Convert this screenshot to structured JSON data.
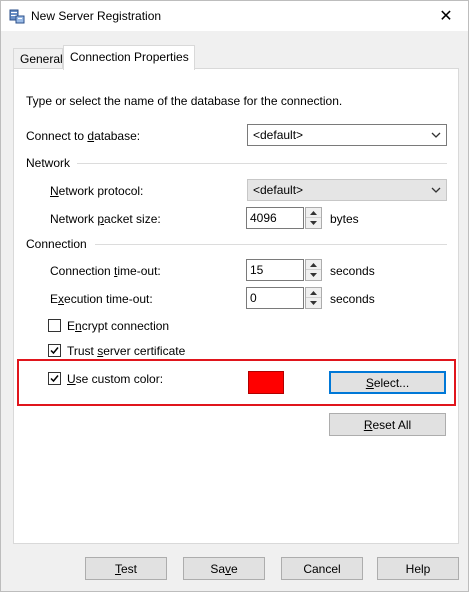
{
  "window": {
    "title": "New Server Registration",
    "close_glyph": "✕"
  },
  "tabs": [
    {
      "label": "General",
      "active": false
    },
    {
      "label": "Connection Properties",
      "active": true
    }
  ],
  "panel": {
    "intro": "Type or select the name of the database for the connection.",
    "connect_db": {
      "label": "Connect to database:",
      "label_parts": [
        "Connect to ",
        "d",
        "atabase:"
      ],
      "value": "<default>"
    },
    "network_group": "Network",
    "network_protocol": {
      "label_parts": [
        "",
        "N",
        "etwork protocol:"
      ],
      "value": "<default>"
    },
    "packet_size": {
      "label_parts": [
        "Network ",
        "p",
        "acket size:"
      ],
      "value": "4096",
      "unit": "bytes"
    },
    "connection_group": "Connection",
    "conn_timeout": {
      "label_parts": [
        "Connection ",
        "t",
        "ime-out:"
      ],
      "value": "15",
      "unit": "seconds"
    },
    "exec_timeout": {
      "label_parts": [
        "E",
        "x",
        "ecution time-out:"
      ],
      "value": "0",
      "unit": "seconds"
    },
    "encrypt": {
      "label_parts": [
        "E",
        "n",
        "crypt connection"
      ],
      "checked": false
    },
    "trust_cert": {
      "label_parts": [
        "Trust ",
        "s",
        "erver certificate"
      ],
      "checked": true
    },
    "custom_color": {
      "label_parts": [
        "",
        "U",
        "se custom color:"
      ],
      "checked": true,
      "swatch_color": "#ff0000",
      "select_parts": [
        "",
        "S",
        "elect..."
      ]
    },
    "reset_parts": [
      "",
      "R",
      "eset All"
    ]
  },
  "footer": {
    "test_parts": [
      "",
      "T",
      "est"
    ],
    "save_parts": [
      "Sa",
      "v",
      "e"
    ],
    "cancel_label": "Cancel",
    "help_label": "Help"
  },
  "highlight_color": "#e0151c"
}
